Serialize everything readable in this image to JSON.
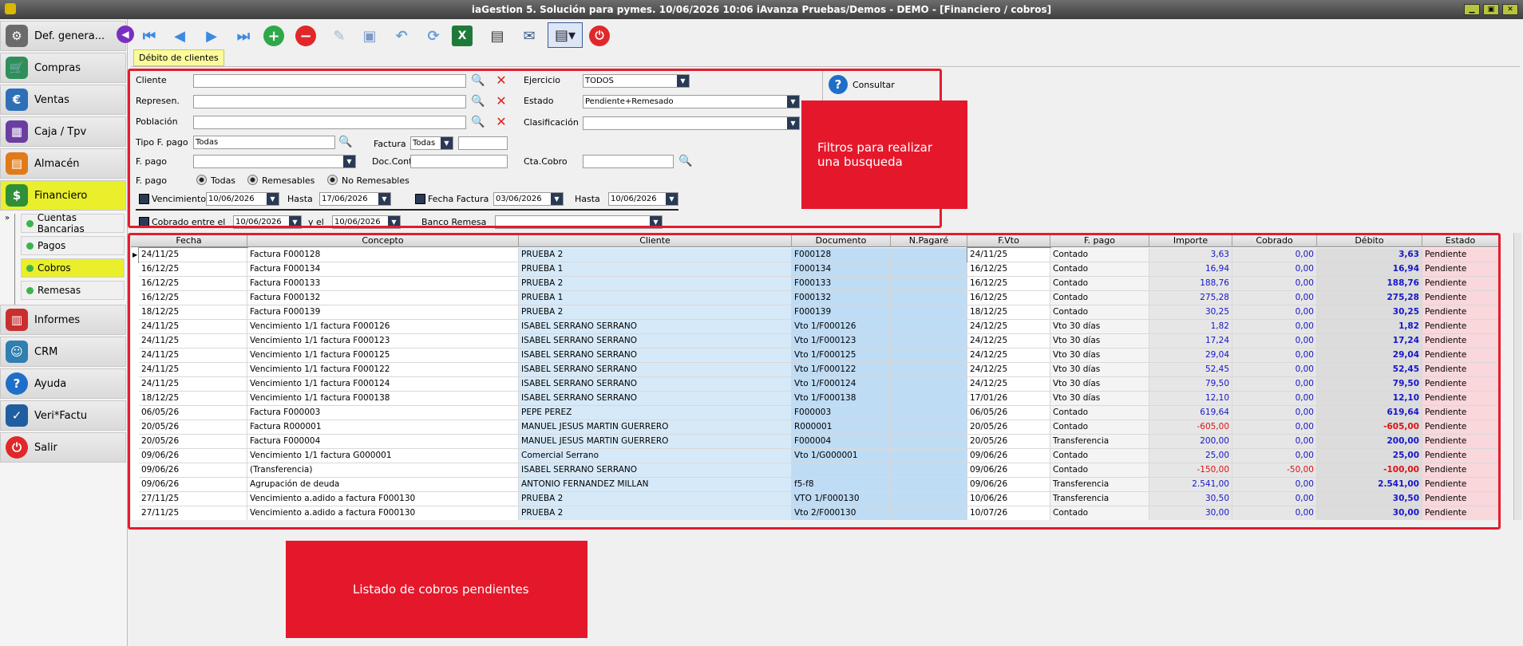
{
  "window": {
    "title": "iaGestion 5. Solución para pymes.   10/06/2026 10:06   iAvanza Pruebas/Demos - DEMO - [Financiero / cobros]",
    "btn_min": "▁",
    "btn_restore": "▣",
    "btn_close": "✕"
  },
  "sidebar": {
    "items": [
      {
        "label": "Def. genera...",
        "icon": "gear-icon",
        "color": "#6b6b6b"
      },
      {
        "label": "Compras",
        "icon": "cart-icon",
        "color": "#2f8f5a"
      },
      {
        "label": "Ventas",
        "icon": "sales-icon",
        "color": "#2f6fb8"
      },
      {
        "label": "Caja / Tpv",
        "icon": "register-icon",
        "color": "#6a3fa0"
      },
      {
        "label": "Almacén",
        "icon": "warehouse-icon",
        "color": "#e07a1a"
      },
      {
        "label": "Financiero",
        "icon": "money-icon",
        "color": "#2f8f3a"
      },
      {
        "label": "Informes",
        "icon": "report-icon",
        "color": "#c82f2f"
      },
      {
        "label": "CRM",
        "icon": "crm-icon",
        "color": "#2f7fb0"
      },
      {
        "label": "Ayuda",
        "icon": "help-icon",
        "color": "#1f6fc8"
      },
      {
        "label": "Veri*Factu",
        "icon": "verifactu-icon",
        "color": "#1f5fa0"
      },
      {
        "label": "Salir",
        "icon": "power-icon",
        "color": "#e0282a"
      }
    ],
    "subitems": [
      "Cuentas Bancarias",
      "Pagos",
      "Cobros",
      "Remesas"
    ]
  },
  "tab": {
    "label": "Débito de clientes"
  },
  "filters": {
    "cliente_label": "Cliente",
    "represen_label": "Represen.",
    "poblacion_label": "Población",
    "tipo_fpago_label": "Tipo F. pago",
    "tipo_fpago_value": "Todas",
    "factura_label": "Factura",
    "factura_value": "Todas",
    "fpago_label": "F. pago",
    "docconta_label": "Doc.Conta",
    "fpago2_label": "F. pago",
    "radio_todas": "Todas",
    "radio_remesables": "Remesables",
    "radio_noremesables": "No Remesables",
    "vencimiento_label": "Vencimiento",
    "vencimiento_value": "10/06/2026",
    "hasta_label": "Hasta",
    "hasta_value": "17/06/2026",
    "fechafactura_label": "Fecha Factura",
    "fechafactura_value": "03/06/2026",
    "hasta2_label": "Hasta",
    "hasta2_value": "10/06/2026",
    "cobrado_label": "Cobrado entre el",
    "cobrado_value": "10/06/2026",
    "yel_label": "y el",
    "yel_value": "10/06/2026",
    "bancoremesa_label": "Banco Remesa",
    "ejercicio_label": "Ejercicio",
    "ejercicio_value": "TODOS",
    "estado_label": "Estado",
    "estado_value": "Pendiente+Remesado",
    "clasificacion_label": "Clasificación",
    "ctacobro_label": "Cta.Cobro",
    "consultar_label": "Consultar"
  },
  "callouts": {
    "filters": "Filtros para realizar una busqueda",
    "list": "Listado de cobros pendientes"
  },
  "grid": {
    "headers": [
      "Fecha",
      "Concepto",
      "Cliente",
      "Documento",
      "N.Pagaré",
      "F.Vto",
      "F. pago",
      "Importe",
      "Cobrado",
      "Débito",
      "Estado"
    ],
    "rows": [
      [
        "24/11/25",
        "Factura F000128",
        "PRUEBA 2",
        "F000128",
        "",
        "24/11/25",
        "Contado",
        "3,63",
        "0,00",
        "3,63",
        "Pendiente"
      ],
      [
        "16/12/25",
        "Factura F000134",
        "PRUEBA 1",
        "F000134",
        "",
        "16/12/25",
        "Contado",
        "16,94",
        "0,00",
        "16,94",
        "Pendiente"
      ],
      [
        "16/12/25",
        "Factura F000133",
        "PRUEBA 2",
        "F000133",
        "",
        "16/12/25",
        "Contado",
        "188,76",
        "0,00",
        "188,76",
        "Pendiente"
      ],
      [
        "16/12/25",
        "Factura F000132",
        "PRUEBA 1",
        "F000132",
        "",
        "16/12/25",
        "Contado",
        "275,28",
        "0,00",
        "275,28",
        "Pendiente"
      ],
      [
        "18/12/25",
        "Factura F000139",
        "PRUEBA 2",
        "F000139",
        "",
        "18/12/25",
        "Contado",
        "30,25",
        "0,00",
        "30,25",
        "Pendiente"
      ],
      [
        "24/11/25",
        "Vencimiento 1/1 factura F000126",
        "ISABEL SERRANO SERRANO",
        "Vto 1/F000126",
        "",
        "24/12/25",
        "Vto 30 días",
        "1,82",
        "0,00",
        "1,82",
        "Pendiente"
      ],
      [
        "24/11/25",
        "Vencimiento 1/1 factura F000123",
        "ISABEL SERRANO SERRANO",
        "Vto 1/F000123",
        "",
        "24/12/25",
        "Vto 30 días",
        "17,24",
        "0,00",
        "17,24",
        "Pendiente"
      ],
      [
        "24/11/25",
        "Vencimiento 1/1 factura F000125",
        "ISABEL SERRANO SERRANO",
        "Vto 1/F000125",
        "",
        "24/12/25",
        "Vto 30 días",
        "29,04",
        "0,00",
        "29,04",
        "Pendiente"
      ],
      [
        "24/11/25",
        "Vencimiento 1/1 factura F000122",
        "ISABEL SERRANO SERRANO",
        "Vto 1/F000122",
        "",
        "24/12/25",
        "Vto 30 días",
        "52,45",
        "0,00",
        "52,45",
        "Pendiente"
      ],
      [
        "24/11/25",
        "Vencimiento 1/1 factura F000124",
        "ISABEL SERRANO SERRANO",
        "Vto 1/F000124",
        "",
        "24/12/25",
        "Vto 30 días",
        "79,50",
        "0,00",
        "79,50",
        "Pendiente"
      ],
      [
        "18/12/25",
        "Vencimiento 1/1 factura F000138",
        "ISABEL SERRANO SERRANO",
        "Vto 1/F000138",
        "",
        "17/01/26",
        "Vto 30 días",
        "12,10",
        "0,00",
        "12,10",
        "Pendiente"
      ],
      [
        "06/05/26",
        "Factura F000003",
        "PEPE PEREZ",
        "F000003",
        "",
        "06/05/26",
        "Contado",
        "619,64",
        "0,00",
        "619,64",
        "Pendiente"
      ],
      [
        "20/05/26",
        "Factura R000001",
        "MANUEL JESUS MARTIN GUERRERO",
        "R000001",
        "",
        "20/05/26",
        "Contado",
        "-605,00",
        "0,00",
        "-605,00",
        "Pendiente"
      ],
      [
        "20/05/26",
        "Factura F000004",
        "MANUEL JESUS MARTIN GUERRERO",
        "F000004",
        "",
        "20/05/26",
        "Transferencia",
        "200,00",
        "0,00",
        "200,00",
        "Pendiente"
      ],
      [
        "09/06/26",
        "Vencimiento 1/1 factura G000001",
        "Comercial Serrano",
        "Vto 1/G000001",
        "",
        "09/06/26",
        "Contado",
        "25,00",
        "0,00",
        "25,00",
        "Pendiente"
      ],
      [
        "09/06/26",
        " (Transferencia)",
        "ISABEL SERRANO SERRANO",
        "",
        "",
        "09/06/26",
        "Contado",
        "-150,00",
        "-50,00",
        "-100,00",
        "Pendiente"
      ],
      [
        "09/06/26",
        "Agrupación de deuda",
        "ANTONIO FERNANDEZ MILLAN",
        "f5-f8",
        "",
        "09/06/26",
        "Transferencia",
        "2.541,00",
        "0,00",
        "2.541,00",
        "Pendiente"
      ],
      [
        "27/11/25",
        "Vencimiento a.adido a factura F000130",
        "PRUEBA 2",
        "VTO 1/F000130",
        "",
        "10/06/26",
        "Transferencia",
        "30,50",
        "0,00",
        "30,50",
        "Pendiente"
      ],
      [
        "27/11/25",
        "Vencimiento a.adido a factura F000130",
        "PRUEBA 2",
        "Vto 2/F000130",
        "",
        "10/07/26",
        "Contado",
        "30,00",
        "0,00",
        "30,00",
        "Pendiente"
      ]
    ]
  },
  "colors": {
    "accent_yellow": "#e9ef2a",
    "callout_red": "#e5182b",
    "cliente_blue": "#d6e9f8",
    "debito_grey": "#dcdcdc",
    "estado_pink": "#f9d7da",
    "positive_blue": "#1515c8",
    "negative_red": "#e01010"
  }
}
